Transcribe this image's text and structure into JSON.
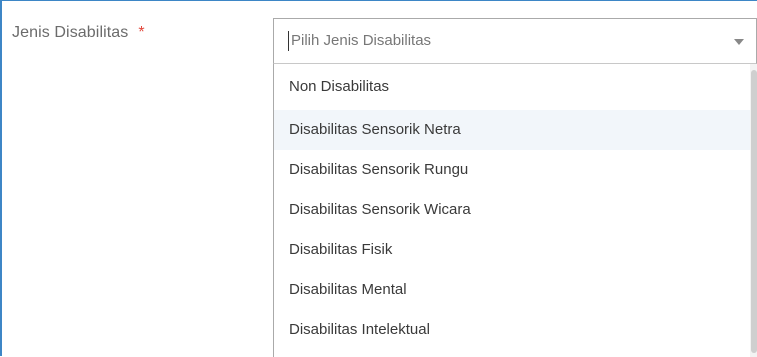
{
  "field": {
    "label": "Jenis Disabilitas",
    "required_mark": "*"
  },
  "select": {
    "placeholder": "Pilih Jenis Disabilitas",
    "caret_icon": "triangle-down-icon"
  },
  "dropdown": {
    "options": [
      "Non Disabilitas",
      "Disabilitas Sensorik Netra",
      "Disabilitas Sensorik Rungu",
      "Disabilitas Sensorik Wicara",
      "Disabilitas Fisik",
      "Disabilitas Mental",
      "Disabilitas Intelektual"
    ],
    "highlighted_index": 1
  },
  "colors": {
    "accent_border": "#3d86c6",
    "required": "#e2463a",
    "highlight": "#f2f6fa"
  }
}
